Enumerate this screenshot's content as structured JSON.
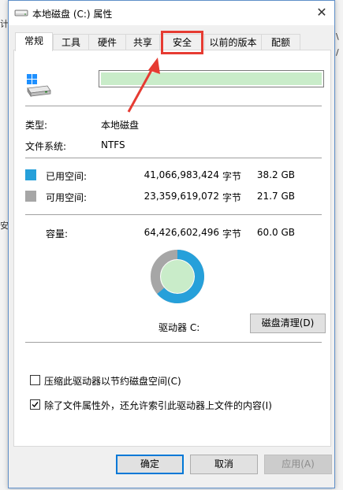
{
  "window": {
    "title": "本地磁盘 (C:) 属性",
    "close_glyph": "✕"
  },
  "background": {
    "left_marks": [
      "计",
      "安"
    ],
    "right_marks": [
      "\\",
      "/"
    ]
  },
  "tabs": [
    {
      "label": "常规",
      "active": true
    },
    {
      "label": "工具",
      "active": false
    },
    {
      "label": "硬件",
      "active": false
    },
    {
      "label": "共享",
      "active": false
    },
    {
      "label": "安全",
      "active": false,
      "highlighted": true
    },
    {
      "label": "以前的版本",
      "active": false
    },
    {
      "label": "配额",
      "active": false
    }
  ],
  "general": {
    "name_value": "",
    "type_label": "类型:",
    "type_value": "本地磁盘",
    "fs_label": "文件系统:",
    "fs_value": "NTFS",
    "used": {
      "label": "已用空间:",
      "bytes": "41,066,983,424",
      "unit": "字节",
      "size": "38.2 GB",
      "color": "#26a0da"
    },
    "free": {
      "label": "可用空间:",
      "bytes": "23,359,619,072",
      "unit": "字节",
      "size": "21.7 GB",
      "color": "#a6a6a6"
    },
    "capacity": {
      "label": "容量:",
      "bytes": "64,426,602,496",
      "unit": "字节",
      "size": "60.0 GB"
    },
    "used_fraction": 0.637,
    "drive_label": "驱动器 C:",
    "cleanup_button": "磁盘清理(D)",
    "compress_label": "压缩此驱动器以节约磁盘空间(C)",
    "compress_checked": false,
    "index_label": "除了文件属性外，还允许索引此驱动器上文件的内容(I)",
    "index_checked": true
  },
  "buttons": {
    "ok": "确定",
    "cancel": "取消",
    "apply": "应用(A)"
  },
  "colors": {
    "annotation": "#e63b32",
    "accent": "#0078d7",
    "name_highlight": "#c9ecc9"
  }
}
